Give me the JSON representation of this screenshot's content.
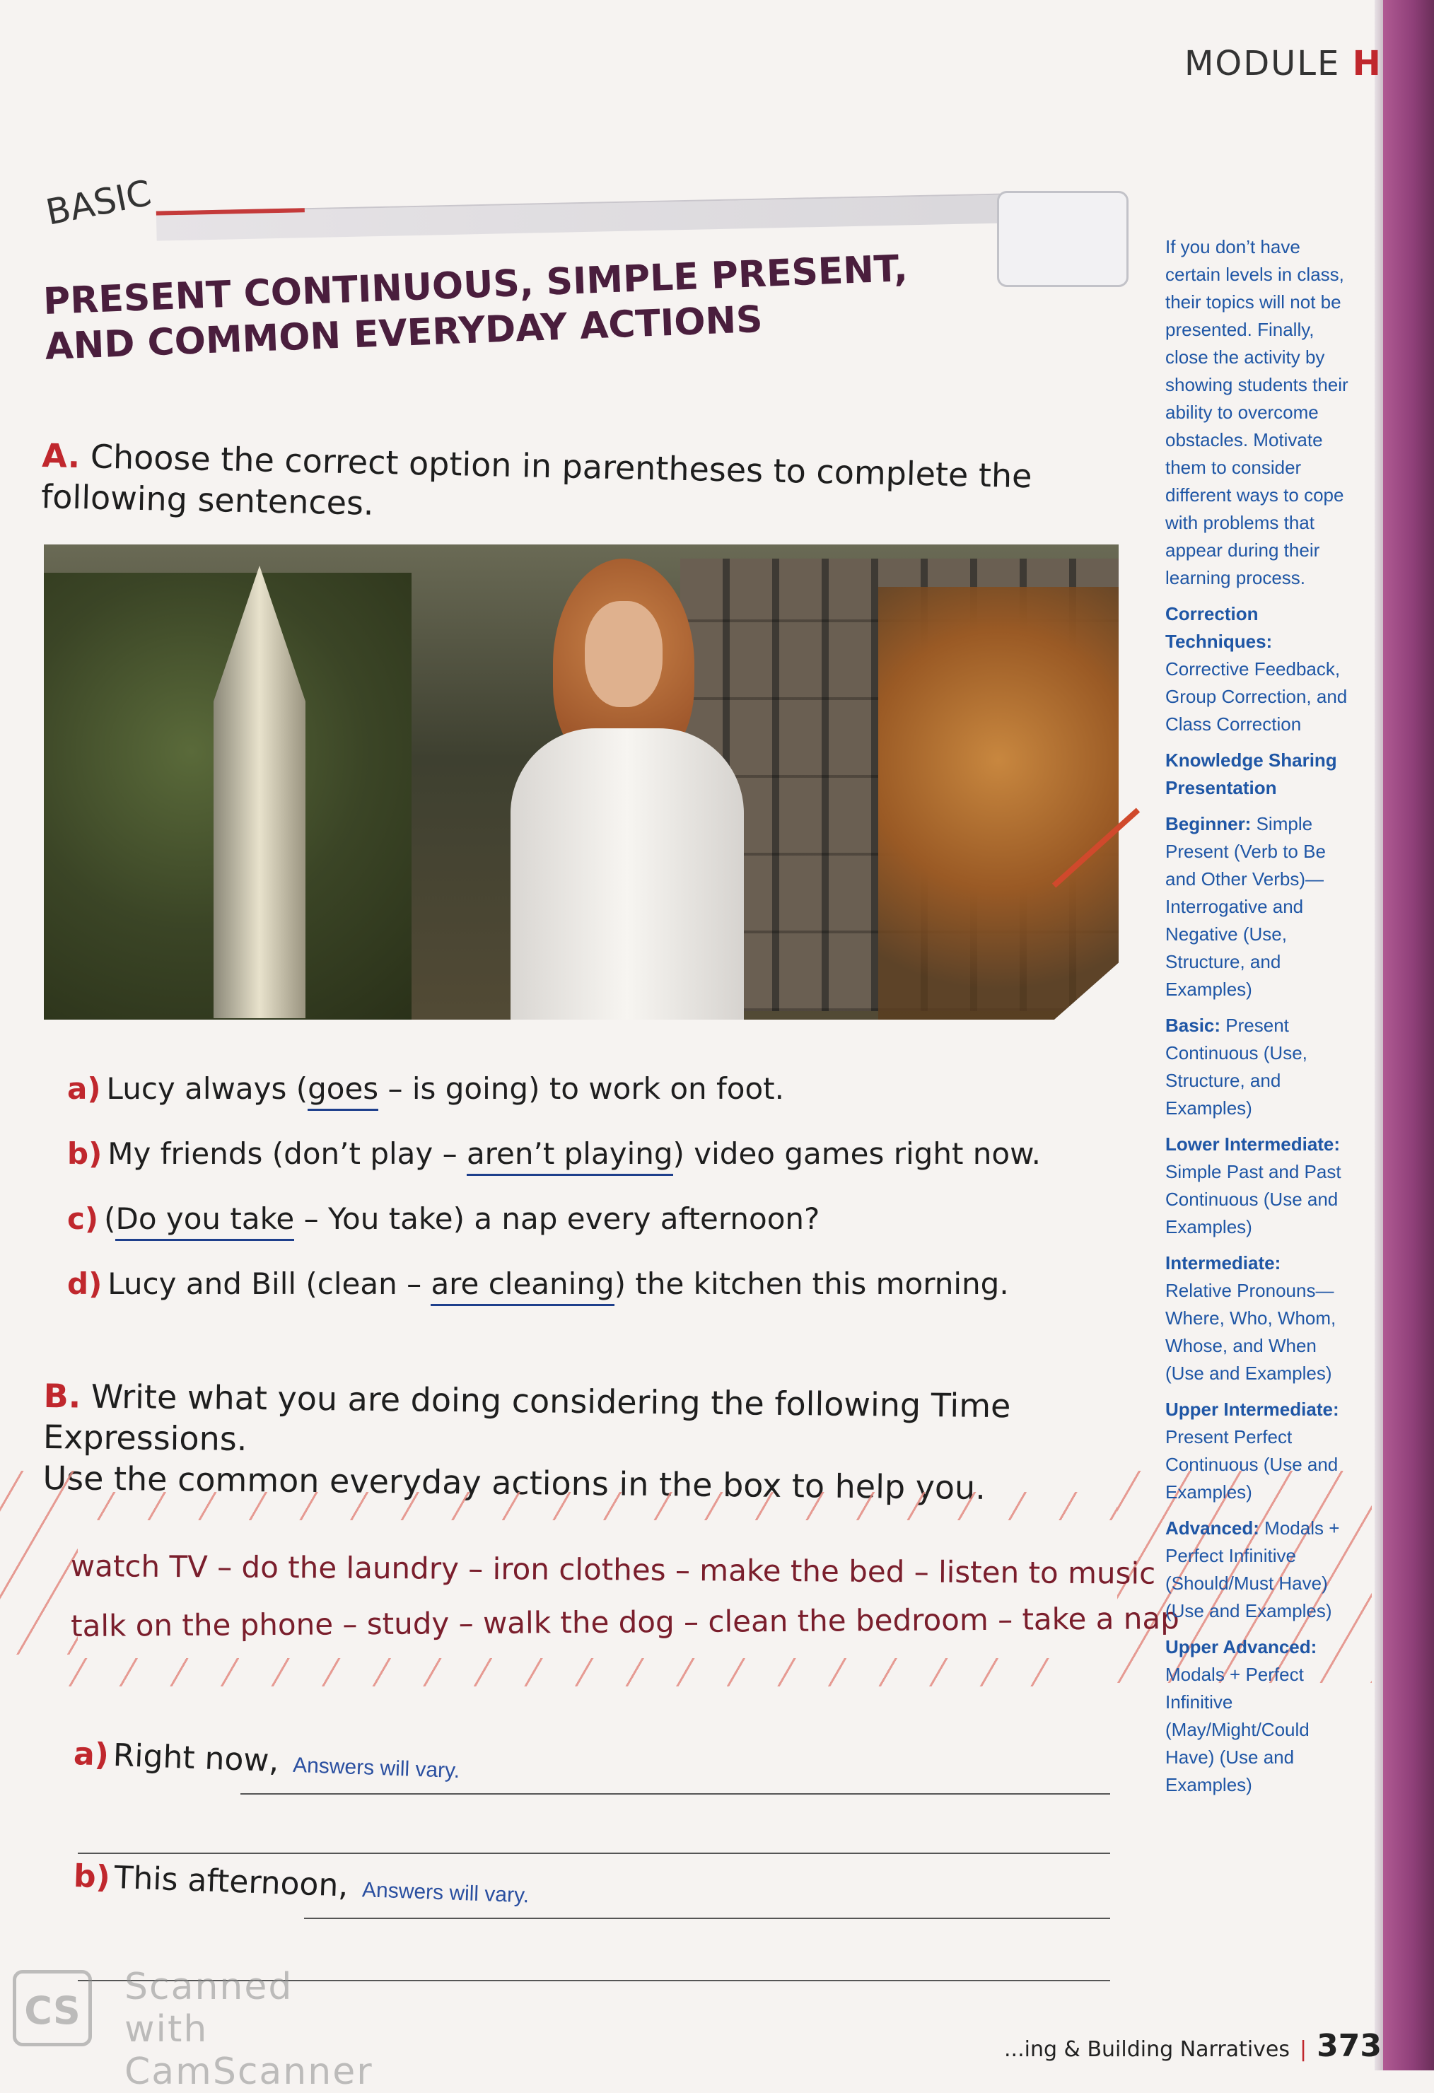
{
  "header": {
    "module_prefix": "MODULE ",
    "module_letter": "H"
  },
  "banner": {
    "level": "BASIC"
  },
  "title": {
    "line1": "PRESENT CONTINUOUS, SIMPLE PRESENT,",
    "line2": "AND COMMON EVERYDAY ACTIONS"
  },
  "section_a": {
    "letter": "A.",
    "instruction": "Choose the correct option in parentheses to complete the following sentences.",
    "items": [
      {
        "letter": "a)",
        "pre": "Lucy always (",
        "answer": "goes",
        "mid": " – is going) to work on foot.",
        "post": ""
      },
      {
        "letter": "b)",
        "pre": "My friends (don’t play – ",
        "answer": "aren’t playing",
        "mid": ") video games right now.",
        "post": ""
      },
      {
        "letter": "c)",
        "pre": "(",
        "answer": "Do you take",
        "mid": " – You take) a nap every afternoon?",
        "post": ""
      },
      {
        "letter": "d)",
        "pre": "Lucy and Bill (clean – ",
        "answer": "are cleaning",
        "mid": ") the kitchen this morning.",
        "post": ""
      }
    ]
  },
  "section_b": {
    "letter": "B.",
    "instruction_line1": "Write what you are doing considering the following Time Expressions.",
    "instruction_line2": "Use the common everyday actions in the box to help you.",
    "word_box_line1": "watch TV – do the laundry – iron clothes – make the bed – listen to music",
    "word_box_line2": "talk on the phone – study – walk the dog – clean the bedroom – take a nap",
    "items": [
      {
        "letter": "a)",
        "prompt": "Right now,",
        "answer": "Answers will vary."
      },
      {
        "letter": "b)",
        "prompt": "This afternoon,",
        "answer": "Answers will vary."
      }
    ]
  },
  "sidebar": {
    "intro": "If you don’t have certain levels in class, their topics will not be presented. Finally, close the activity by showing students their ability to overcome obstacles. Motivate them to consider different ways to cope with problems that appear during their learning process.",
    "correction_label": "Correction Techniques:",
    "correction_text": "Corrective Feedback, Group Correction, and Class Correction",
    "knowledge_label": "Knowledge Sharing Presentation",
    "levels": [
      {
        "label": "Beginner:",
        "text": "Simple Present (Verb to Be and Other Verbs)—Interrogative and Negative (Use, Structure, and Examples)"
      },
      {
        "label": "Basic:",
        "text": "Present Continuous (Use, Structure, and Examples)"
      },
      {
        "label": "Lower Intermediate:",
        "text": "Simple Past and Past Continuous (Use and Examples)"
      },
      {
        "label": "Intermediate:",
        "text": "Relative Pronouns—Where, Who, Whom, Whose, and When (Use and Examples)"
      },
      {
        "label": "Upper Intermediate:",
        "text": "Present Perfect Continuous (Use and Examples)"
      },
      {
        "label": "Advanced:",
        "text": "Modals + Perfect Infinitive (Should/Must Have) (Use and Examples)"
      },
      {
        "label": "Upper Advanced:",
        "text": "Modals + Perfect Infinitive (May/Might/Could Have) (Use and Examples)"
      }
    ]
  },
  "footer": {
    "section": "...ing & Building Narratives",
    "separator": "|",
    "page": "373"
  },
  "watermark": {
    "logo": "CS",
    "line1": "Scanned with",
    "line2": "CamScanner"
  },
  "colors": {
    "accent_red": "#c0272d",
    "title_plum": "#4a1e3d",
    "sidebar_blue": "#1f56a5",
    "answer_blue": "#1e3f8c",
    "page_edge": "#8e3f78"
  }
}
